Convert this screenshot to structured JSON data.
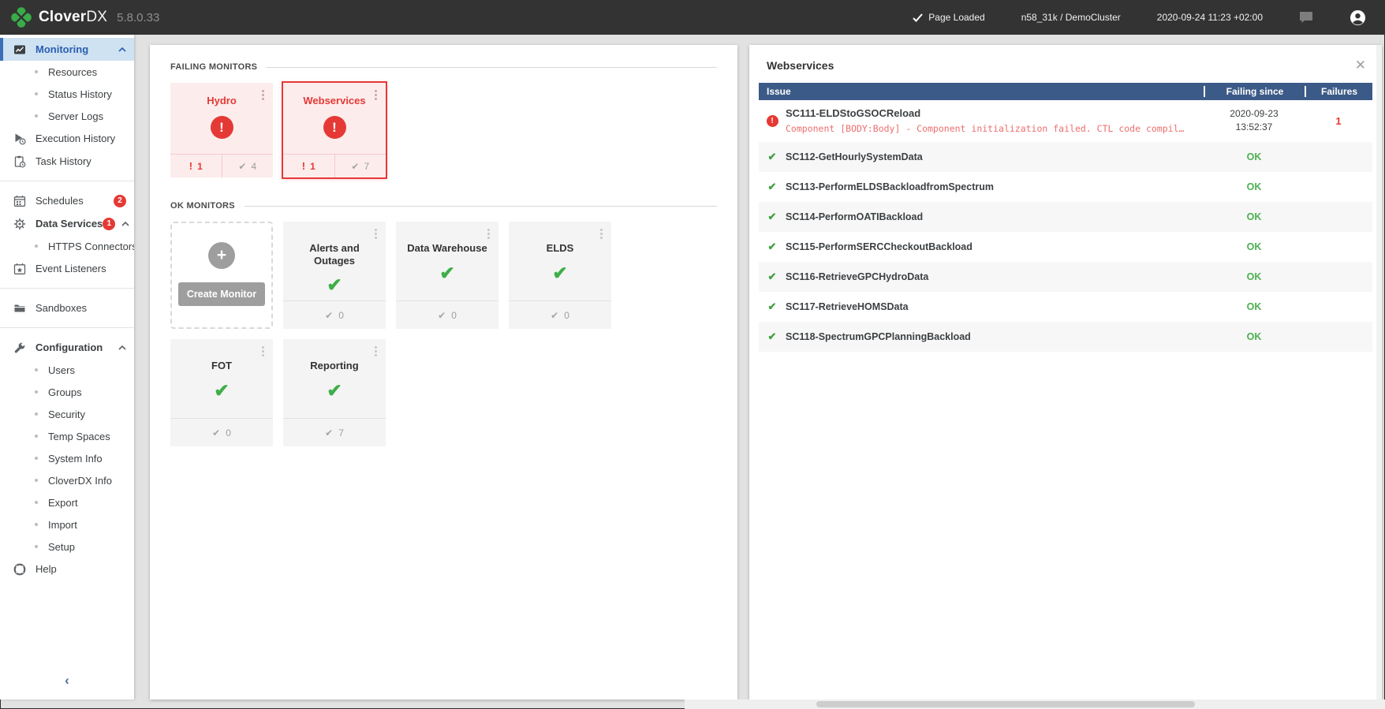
{
  "topbar": {
    "brand_bold": "Clover",
    "brand_light": "DX",
    "version": "5.8.0.33",
    "status_label": "Page Loaded",
    "cluster_label": "n58_31k / DemoCluster",
    "datetime_label": "2020-09-24 11:23 +02:00"
  },
  "sidebar": {
    "monitoring": {
      "label": "Monitoring"
    },
    "resources": {
      "label": "Resources"
    },
    "status_history": {
      "label": "Status History"
    },
    "server_logs": {
      "label": "Server Logs"
    },
    "execution_history": {
      "label": "Execution History"
    },
    "task_history": {
      "label": "Task History"
    },
    "schedules": {
      "label": "Schedules",
      "badge": "2"
    },
    "data_services": {
      "label": "Data Services",
      "badge": "1"
    },
    "https_connectors": {
      "label": "HTTPS Connectors"
    },
    "event_listeners": {
      "label": "Event Listeners"
    },
    "sandboxes": {
      "label": "Sandboxes"
    },
    "configuration": {
      "label": "Configuration"
    },
    "users": {
      "label": "Users"
    },
    "groups": {
      "label": "Groups"
    },
    "security": {
      "label": "Security"
    },
    "temp_spaces": {
      "label": "Temp Spaces"
    },
    "system_info": {
      "label": "System Info"
    },
    "cloverdx_info": {
      "label": "CloverDX Info"
    },
    "export": {
      "label": "Export"
    },
    "import": {
      "label": "Import"
    },
    "setup": {
      "label": "Setup"
    },
    "help": {
      "label": "Help"
    },
    "collapse_glyph": "‹"
  },
  "monitors": {
    "failing_section_label": "FAILING MONITORS",
    "ok_section_label": "OK MONITORS",
    "create_label": "Create Monitor",
    "failing": [
      {
        "name": "Hydro",
        "fail_count": "1",
        "ok_count": "4"
      },
      {
        "name": "Webservices",
        "fail_count": "1",
        "ok_count": "7"
      }
    ],
    "ok": [
      {
        "name": "Alerts and Outages",
        "ok_count": "0"
      },
      {
        "name": "Data Warehouse",
        "ok_count": "0"
      },
      {
        "name": "ELDS",
        "ok_count": "0"
      },
      {
        "name": "FOT",
        "ok_count": "0"
      },
      {
        "name": "Reporting",
        "ok_count": "7"
      }
    ]
  },
  "panel": {
    "title": "Webservices",
    "columns": {
      "issue": "Issue",
      "failing_since": "Failing since",
      "failures": "Failures"
    },
    "error_row": {
      "name": "SC111-ELDStoGSOCReload",
      "detail": "Component [BODY:Body] - Component initialization failed. CTL code compil…",
      "date": "2020-09-23",
      "time": "13:52:37",
      "failures": "1"
    },
    "ok_rows": [
      {
        "name": "SC112-GetHourlySystemData",
        "status": "OK"
      },
      {
        "name": "SC113-PerformELDSBackloadfromSpectrum",
        "status": "OK"
      },
      {
        "name": "SC114-PerformOATIBackload",
        "status": "OK"
      },
      {
        "name": "SC115-PerformSERCCheckoutBackload",
        "status": "OK"
      },
      {
        "name": "SC116-RetrieveGPCHydroData",
        "status": "OK"
      },
      {
        "name": "SC117-RetrieveHOMSData",
        "status": "OK"
      },
      {
        "name": "SC118-SpectrumGPCPlanningBackload",
        "status": "OK"
      }
    ]
  },
  "colors": {
    "brand_green": "#3aab49",
    "error_red": "#e53935",
    "ok_green": "#43a047",
    "table_header_blue": "#3c5a87",
    "active_nav_blue": "#2a5db0",
    "active_nav_bg": "#cfe2f2"
  }
}
